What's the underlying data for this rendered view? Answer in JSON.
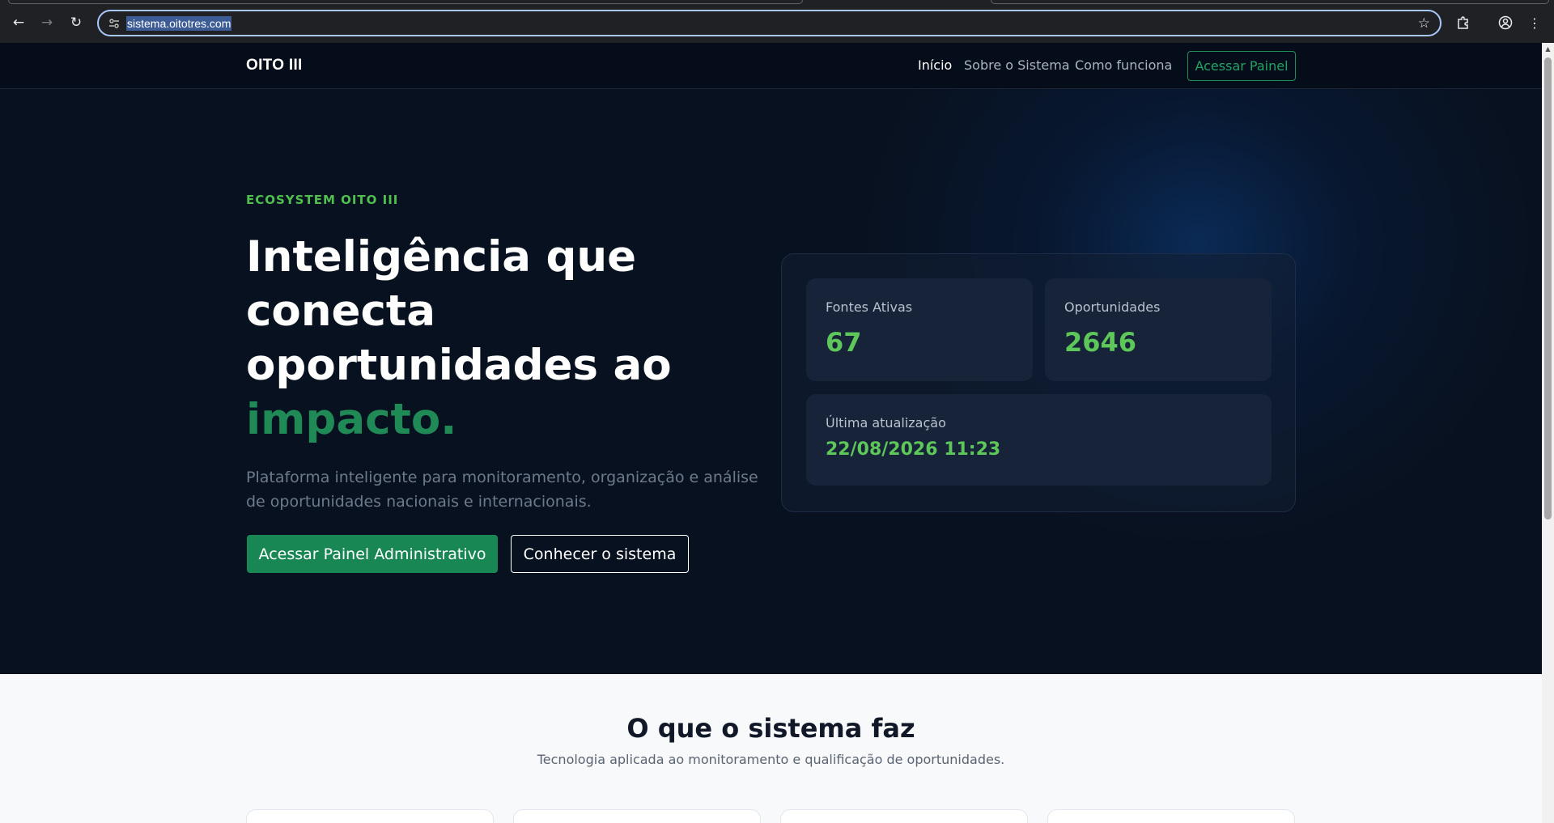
{
  "browser": {
    "url": "sistema.oitotres.com",
    "icons": {
      "back": "arrow-left-icon",
      "forward": "arrow-right-icon",
      "reload": "reload-icon",
      "site_info": "site-settings-icon",
      "bookmark": "star-icon",
      "extensions": "puzzle-icon",
      "profile": "profile-icon",
      "menu": "kebab-menu-icon"
    }
  },
  "header": {
    "brand": "OITO III",
    "nav": [
      "Início",
      "Sobre o Sistema",
      "Como funciona"
    ],
    "cta": "Acessar Painel"
  },
  "hero": {
    "eyebrow": "ECOSYSTEM OITO III",
    "headline_lines": [
      "Inteligência que",
      "conecta",
      "oportunidades ao"
    ],
    "headline_accent": "impacto.",
    "lead": "Plataforma inteligente para monitoramento, organização e análise de oportunidades nacionais e internacionais.",
    "primary_button": "Acessar Painel Administrativo",
    "secondary_button": "Conhecer o sistema"
  },
  "stats": {
    "sources_label": "Fontes Ativas",
    "sources_value": "67",
    "opportunities_label": "Oportunidades",
    "opportunities_value": "2646",
    "updated_label": "Última atualização",
    "updated_value": "22/08/2026 11:23"
  },
  "section": {
    "title": "O que o sistema faz",
    "subtitle": "Tecnologia aplicada ao monitoramento e qualificação de oportunidades."
  },
  "colors": {
    "accent_green": "#198754",
    "stat_green": "#5ec75a",
    "hero_bg": "#08111f"
  }
}
